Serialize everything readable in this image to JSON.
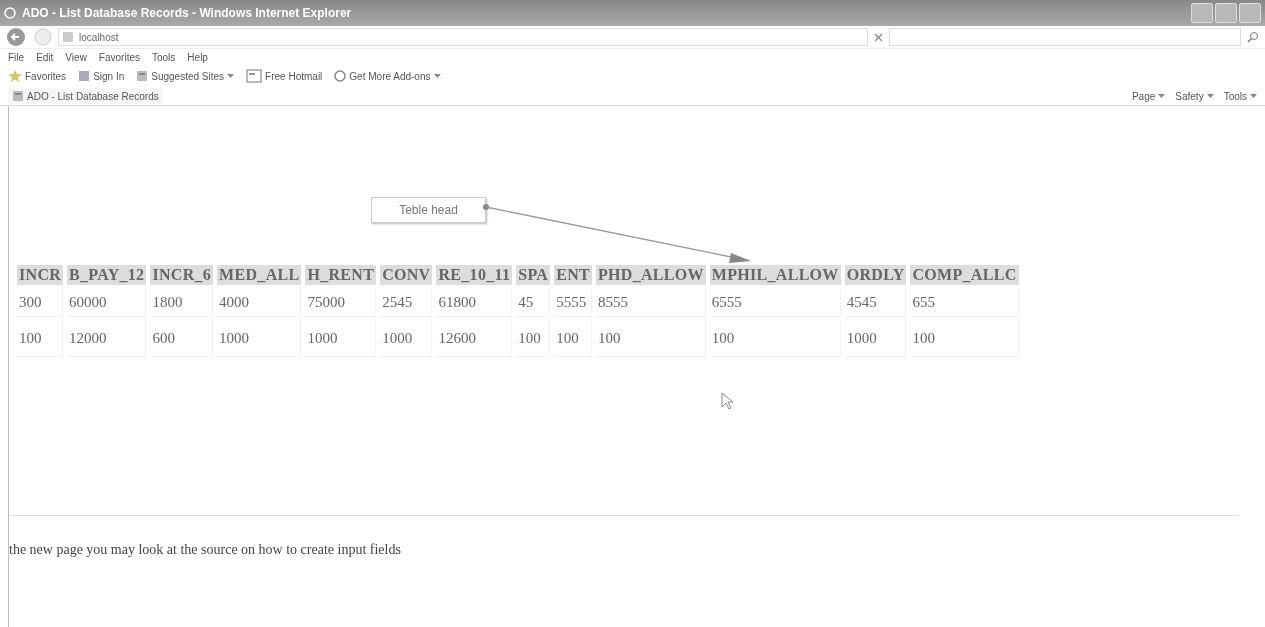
{
  "window": {
    "title": "ADO - List Database Records - Windows Internet Explorer"
  },
  "address_bar": {
    "value": "localhost"
  },
  "menu": [
    "File",
    "Edit",
    "View",
    "Favorites",
    "Tools",
    "Help"
  ],
  "favorites_bar": [
    {
      "label": "Favorites",
      "kind": "star",
      "dropdown": false
    },
    {
      "label": "Sign In",
      "kind": "sign",
      "dropdown": false
    },
    {
      "label": "Suggested Sites",
      "kind": "sites",
      "dropdown": true
    },
    {
      "label": "Free Hotmail",
      "kind": "page",
      "dropdown": false
    },
    {
      "label": "Get More Add-ons",
      "kind": "addon",
      "dropdown": true
    }
  ],
  "tab": {
    "label": "ADO - List Database Records"
  },
  "command_bar": [
    "Page",
    "Safety",
    "Tools"
  ],
  "callout": {
    "label": "Teble head"
  },
  "table": {
    "columns": [
      "INCR",
      "B_PAY_12",
      "INCR_6",
      "MED_ALL",
      "H_RENT",
      "CONV",
      "RE_10_11",
      "SPA",
      "ENT",
      "PHD_ALLOW",
      "MPHIL_ALLOW",
      "ORDLY",
      "COMP_ALLC"
    ],
    "rows": [
      [
        "300",
        "60000",
        "1800",
        "4000",
        "75000",
        "2545",
        "61800",
        "45",
        "5555",
        "8555",
        "6555",
        "4545",
        "655"
      ],
      [
        "100",
        "12000",
        "600",
        "1000",
        "1000",
        "1000",
        "12600",
        "100",
        "100",
        "100",
        "100",
        "1000",
        "100"
      ]
    ]
  },
  "footer_text": "the new page you may look at the source on how to create input fields"
}
